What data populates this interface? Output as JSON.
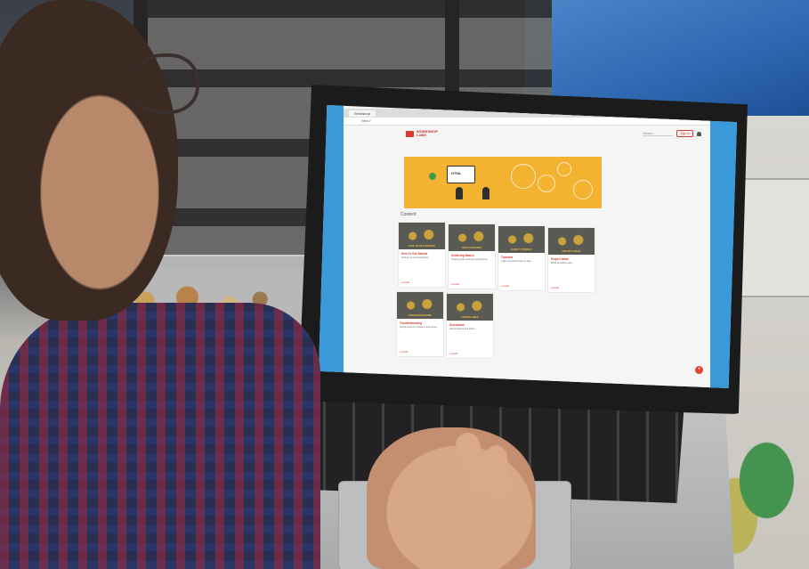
{
  "browser": {
    "tab_label": "Workshop",
    "url": "https://"
  },
  "site": {
    "logo_line1": "WORKSHOP",
    "logo_line2": "LABS",
    "search_placeholder": "Search...",
    "signin_label": "Sign in",
    "section_title": "Content"
  },
  "banner": {
    "screen_label": "HTML",
    "accent_color": "#f3b230"
  },
  "cards": [
    {
      "image_label": "HOW TO GET STARTED",
      "title": "How To Get Started",
      "desc": "Setting up your workspace",
      "footer": "● Guide"
    },
    {
      "image_label": "HOW TO SOLDER",
      "title": "Soldering Basics",
      "desc": "Simple guide to joining components",
      "footer": "● Guide"
    },
    {
      "image_label": "BASIC TUTORIALS",
      "title": "Tutorials",
      "desc": "Learn the basics step by step",
      "footer": "● Guide"
    },
    {
      "image_label": "PROJECT IDEAS",
      "title": "Project Ideas",
      "desc": "Build something new",
      "footer": "● Guide"
    },
    {
      "image_label": "TROUBLESHOOTING",
      "title": "Troubleshooting",
      "desc": "Fixing common problems and issues",
      "footer": "● Guide"
    },
    {
      "image_label": "FORUM & HELP",
      "title": "Discussion",
      "desc": "Ask questions and share",
      "footer": "● Guide"
    }
  ],
  "colors": {
    "brand": "#d9382e",
    "wallpaper": "#3a9ad9"
  },
  "icons": [
    "bell-icon",
    "plus-icon"
  ]
}
